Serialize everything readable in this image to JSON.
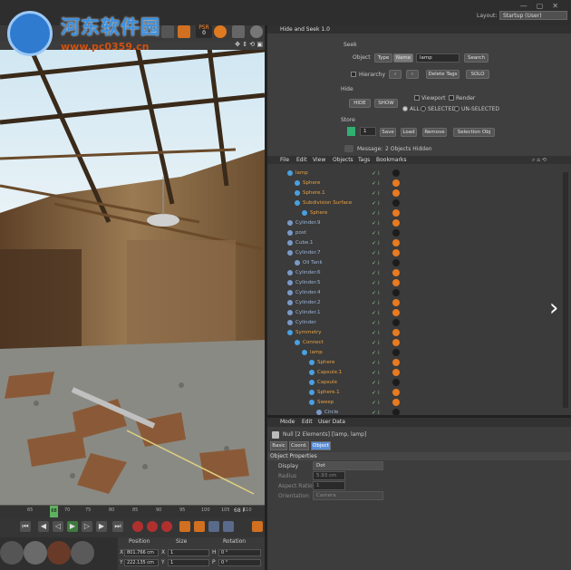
{
  "watermark": {
    "title": "河东软件园",
    "url": "www.pc0359.cn"
  },
  "window": {
    "layout_label": "Layout:",
    "layout_value": "Startup (User)"
  },
  "toolbar": {
    "psr_label": "PSR",
    "psr_value": "0"
  },
  "timeline": {
    "ticks": [
      "65",
      "70",
      "75",
      "80",
      "85",
      "90",
      "95",
      "100",
      "105",
      "110"
    ],
    "current": "68",
    "end": "68 F"
  },
  "coords": {
    "headers": [
      "Position",
      "Size",
      "Rotation"
    ],
    "rows": [
      {
        "axis": "X",
        "pos": "801.766 cm",
        "size_axis": "X",
        "size": "1",
        "rot_axis": "H",
        "rot": "0 °"
      },
      {
        "axis": "Y",
        "pos": "222.135 cm",
        "size_axis": "Y",
        "size": "1",
        "rot_axis": "P",
        "rot": "0 °"
      }
    ]
  },
  "hide_seek": {
    "title": "Hide and Seek 1.0",
    "seek_label": "Seek",
    "object_label": "Object",
    "type_btn": "Type",
    "name_btn": "Name",
    "name_value": "lamp",
    "search_btn": "Search",
    "hierarchy_label": "Hierarchy",
    "prev_btn": "‹",
    "next_btn": "›",
    "delete_tags_btn": "Delete Tags",
    "solo_btn": "SOLO",
    "hide_label": "Hide",
    "hide_btn": "HIDE",
    "show_btn": "SHOW",
    "viewport_label": "Viewport",
    "render_label": "Render",
    "all_label": "ALL",
    "selected_label": "SELECTED",
    "unselected_label": "UN-SELECTED",
    "store_label": "Store",
    "store_value": "1",
    "save_btn": "Save",
    "load_btn": "Load",
    "remove_btn": "Remove",
    "selection_obj_btn": "Selection Obj",
    "message_label": "Message:",
    "message_value": "2 Objects Hidden"
  },
  "object_manager": {
    "menu": [
      "File",
      "Edit",
      "View",
      "Objects",
      "Tags",
      "Bookmarks"
    ],
    "rows": [
      {
        "name": "lamp",
        "indent": 0,
        "color": "#e8a040"
      },
      {
        "name": "Sphere",
        "indent": 1,
        "color": "#e8a040"
      },
      {
        "name": "Sphere.1",
        "indent": 1,
        "color": "#e8a040"
      },
      {
        "name": "Subdivision Surface",
        "indent": 1,
        "color": "#e8a040"
      },
      {
        "name": "Sphere",
        "indent": 2,
        "color": "#e8a040"
      },
      {
        "name": "Cylinder.9",
        "indent": 0,
        "color": "#9ab4d8"
      },
      {
        "name": "post",
        "indent": 0,
        "color": "#9ab4d8"
      },
      {
        "name": "Cube.1",
        "indent": 0,
        "color": "#9ab4d8"
      },
      {
        "name": "Cylinder.7",
        "indent": 0,
        "color": "#9ab4d8"
      },
      {
        "name": "Oil Tank",
        "indent": 1,
        "color": "#9ab4d8"
      },
      {
        "name": "Cylinder.6",
        "indent": 0,
        "color": "#9ab4d8"
      },
      {
        "name": "Cylinder.5",
        "indent": 0,
        "color": "#9ab4d8"
      },
      {
        "name": "Cylinder.4",
        "indent": 0,
        "color": "#9ab4d8"
      },
      {
        "name": "Cylinder.2",
        "indent": 0,
        "color": "#9ab4d8"
      },
      {
        "name": "Cylinder.1",
        "indent": 0,
        "color": "#9ab4d8"
      },
      {
        "name": "Cylinder",
        "indent": 0,
        "color": "#9ab4d8"
      },
      {
        "name": "Symmetry",
        "indent": 0,
        "color": "#e8a040"
      },
      {
        "name": "Connect",
        "indent": 1,
        "color": "#e8a040"
      },
      {
        "name": "lamp",
        "indent": 2,
        "color": "#e8a040"
      },
      {
        "name": "Sphere",
        "indent": 3,
        "color": "#e8a040"
      },
      {
        "name": "Capsule.1",
        "indent": 3,
        "color": "#e8a040"
      },
      {
        "name": "Capsule",
        "indent": 3,
        "color": "#e8a040"
      },
      {
        "name": "Sphere.1",
        "indent": 3,
        "color": "#e8a040"
      },
      {
        "name": "Sweep",
        "indent": 3,
        "color": "#e8a040"
      },
      {
        "name": "Circle",
        "indent": 4,
        "color": "#9ab4d8"
      }
    ]
  },
  "attributes": {
    "menu": [
      "Mode",
      "Edit",
      "User Data"
    ],
    "object_title": "Null [2 Elements] [lamp, lamp]",
    "tabs": [
      "Basic",
      "Coord.",
      "Object"
    ],
    "section": "Object Properties",
    "fields": [
      {
        "label": "Display",
        "value": "Dot"
      },
      {
        "label": "Radius",
        "value": "5.93 cm"
      },
      {
        "label": "Aspect Ratio",
        "value": "1"
      },
      {
        "label": "Orientation",
        "value": "Camera"
      }
    ]
  },
  "colors": {
    "accent": "#2f7bd0",
    "selected_text": "#e8a040",
    "active_tab": "#5b8fd8"
  }
}
